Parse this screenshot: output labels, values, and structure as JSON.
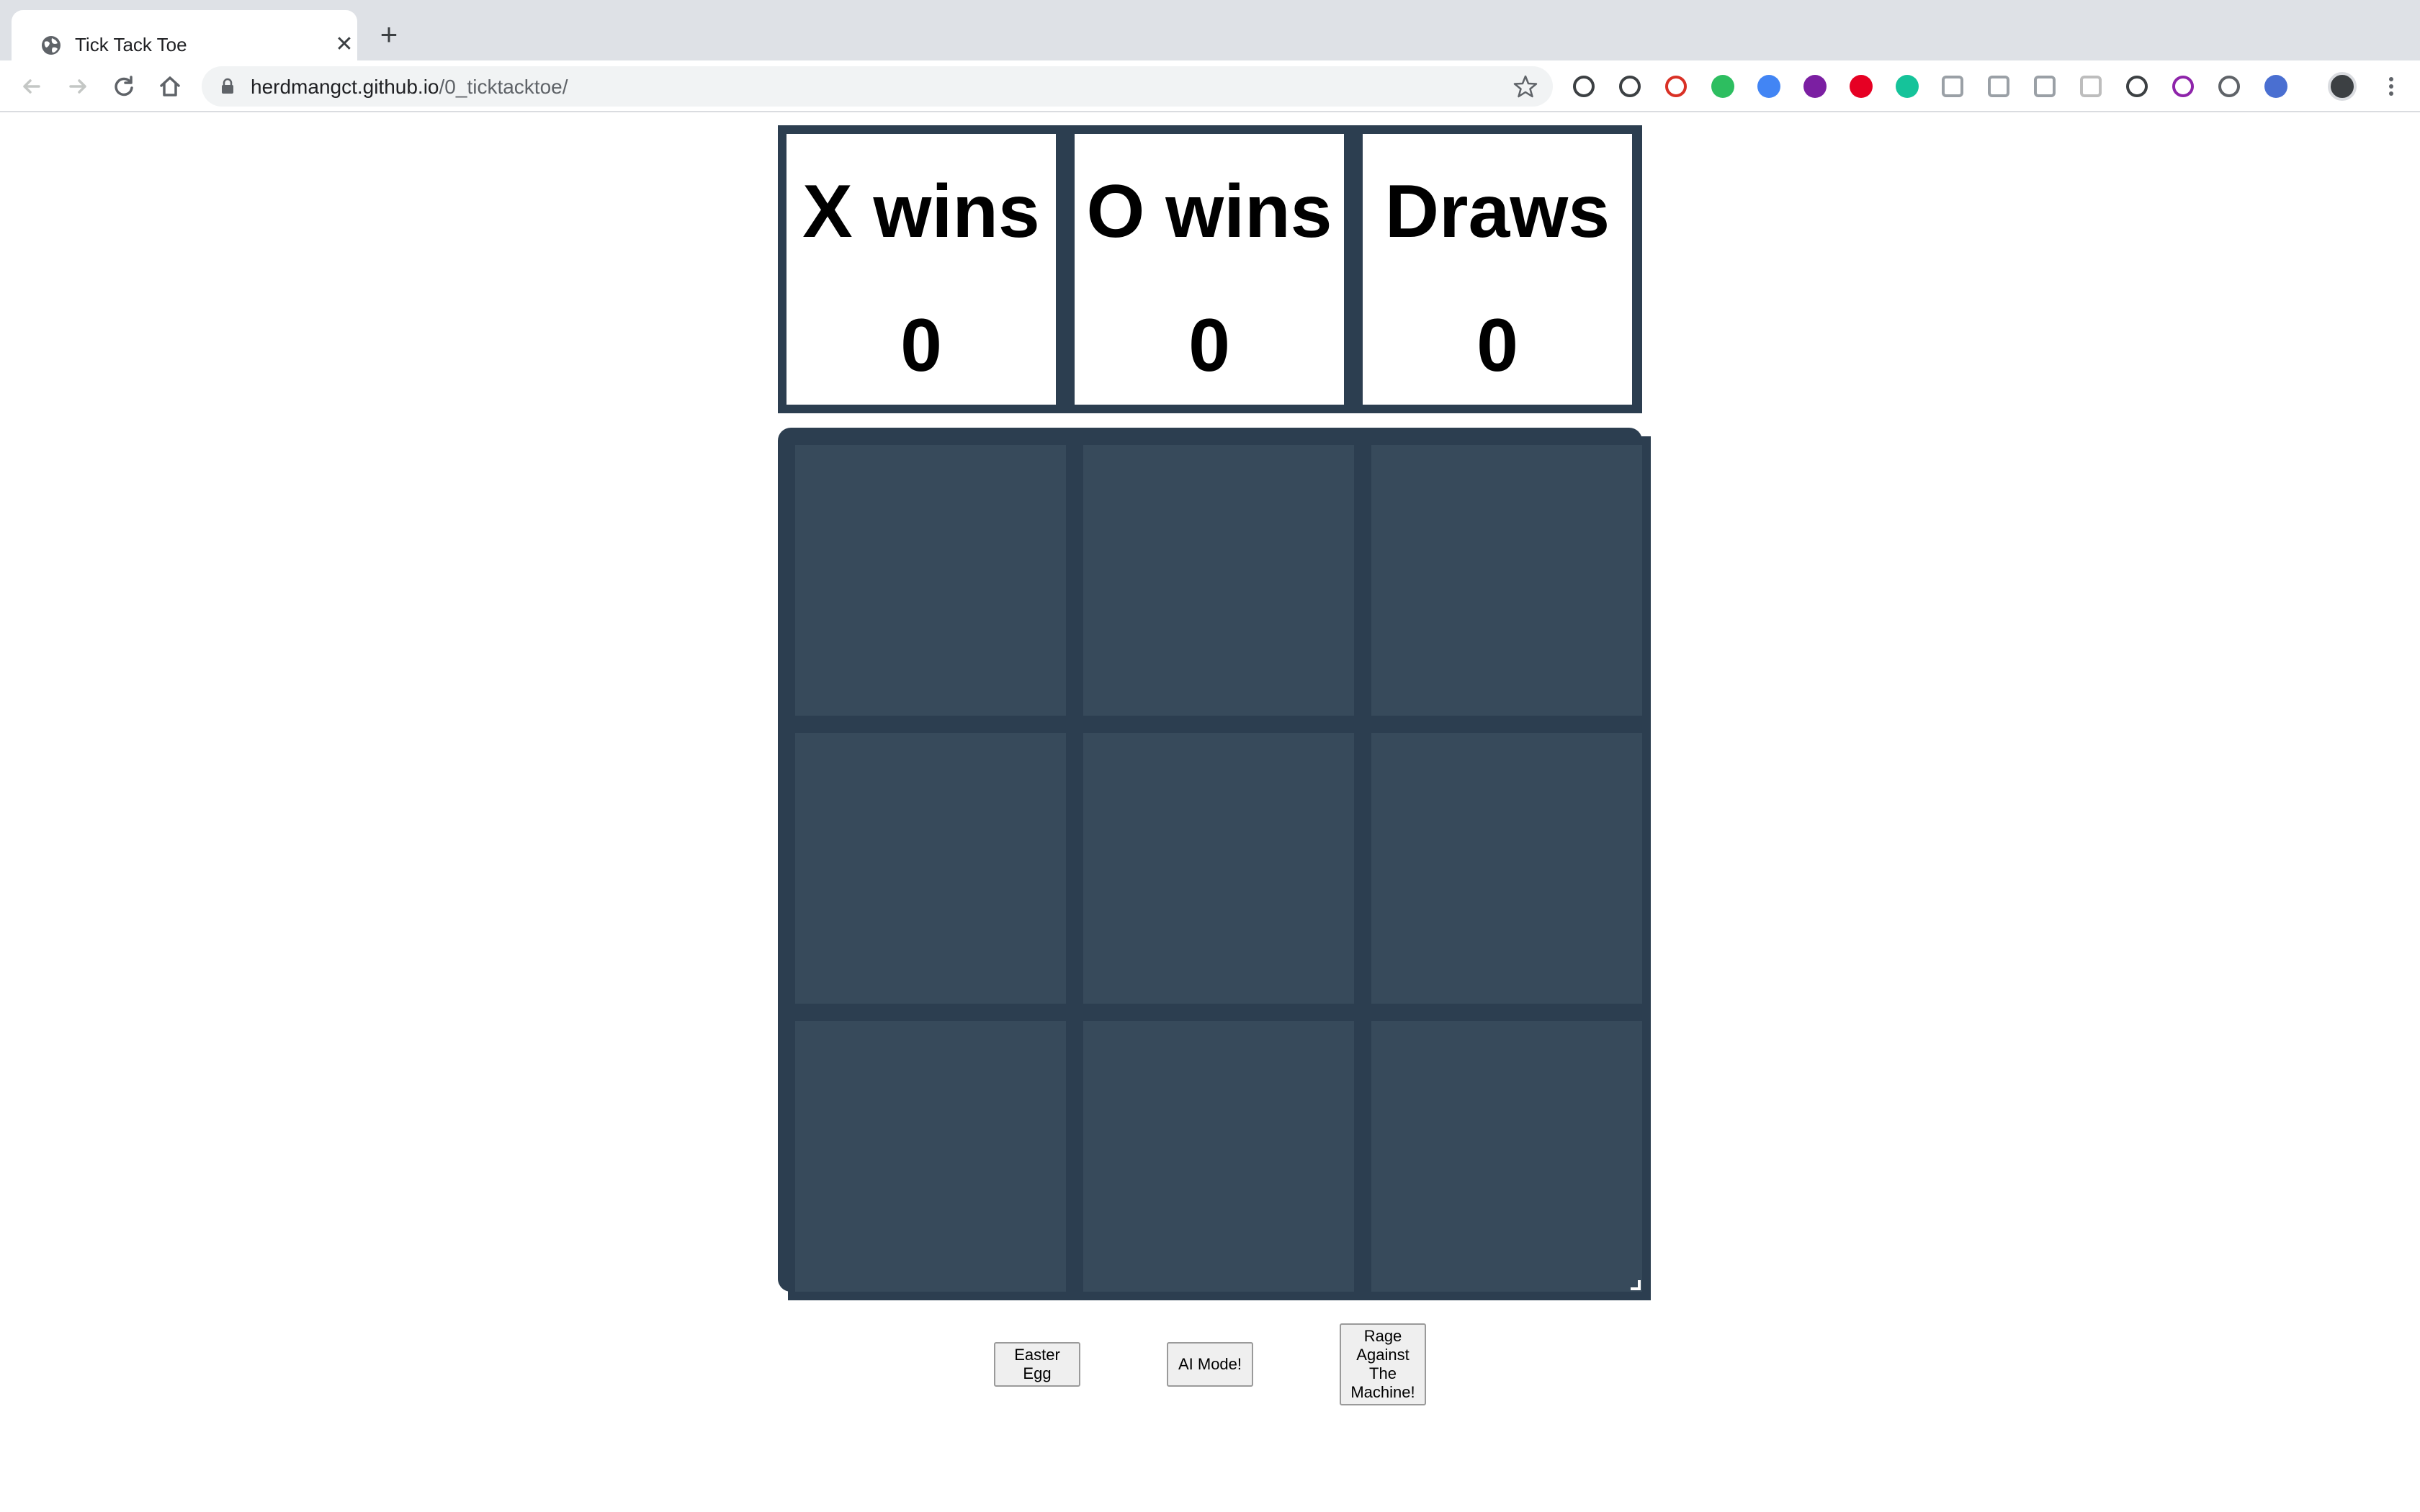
{
  "browser": {
    "tab": {
      "title": "Tick Tack Toe",
      "close": "✕"
    },
    "new_tab": "+",
    "url": {
      "host": "herdmangct.github.io",
      "path": "/0_ticktacktoe/"
    },
    "extensions": [
      "rocket-icon",
      "magnifier-icon",
      "clipboard-icon",
      "evernote-icon",
      "s-icon",
      "c-icon",
      "pinterest-icon",
      "grammarly-icon",
      "grid-icon",
      "cast-icon",
      "camera-icon",
      "qr-icon",
      "ellipsis-circle-icon",
      "chat-icon",
      "link-icon",
      "translate-icon",
      "avatar"
    ]
  },
  "scoreboard": {
    "items": [
      {
        "label": "X wins",
        "value": "0"
      },
      {
        "label": "O wins",
        "value": "0"
      },
      {
        "label": "Draws",
        "value": "0"
      }
    ]
  },
  "board": {
    "cells": [
      "",
      "",
      "",
      "",
      "",
      "",
      "",
      "",
      ""
    ]
  },
  "buttons": {
    "easter_egg": "Easter Egg",
    "ai_mode": "AI Mode!",
    "rage": "Rage Against The Machine!"
  },
  "colors": {
    "board": "#2c3e50",
    "cell": "#374a5b",
    "chrome_tabstrip": "#dee1e6"
  }
}
